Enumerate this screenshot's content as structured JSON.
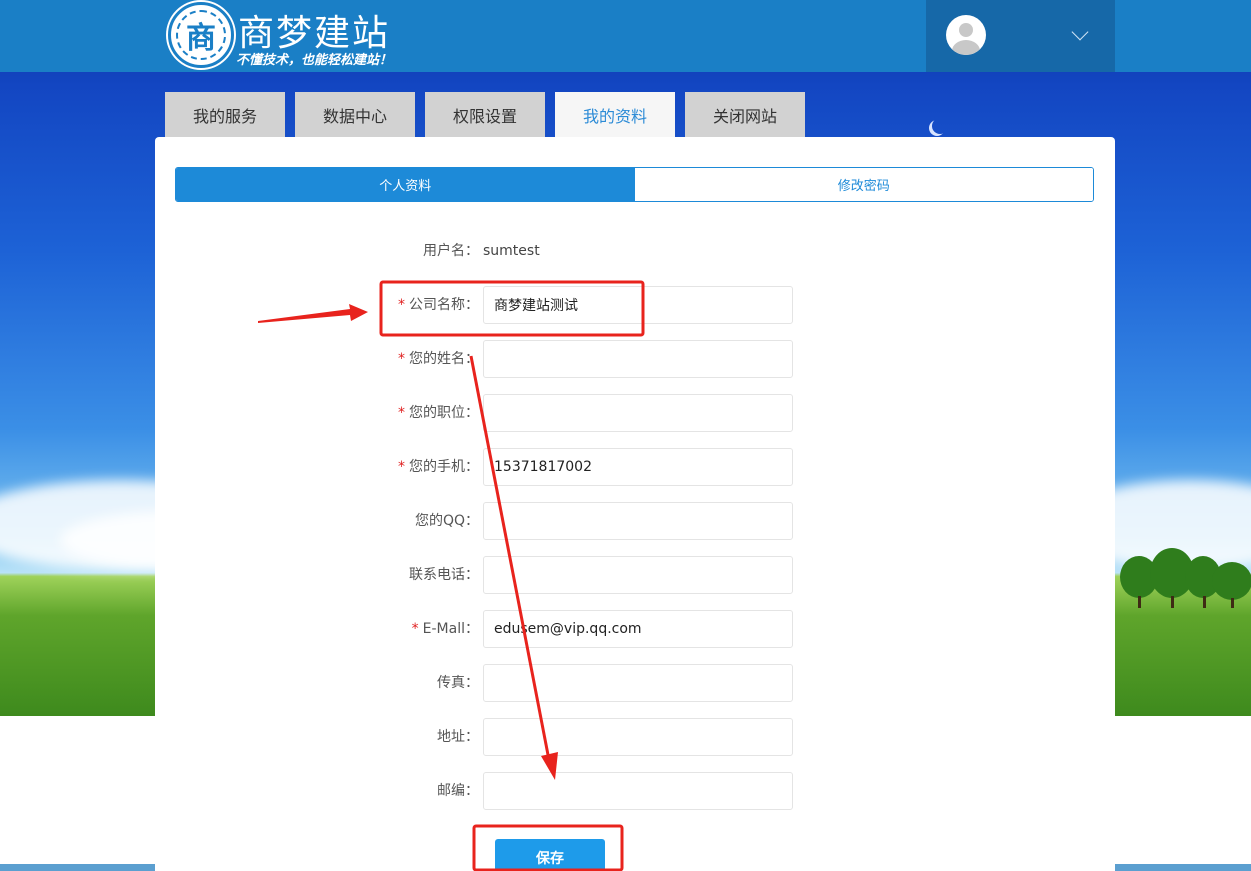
{
  "header": {
    "logo_glyph": "商",
    "brand_title": "商梦建站",
    "brand_slogan": "不懂技术，也能轻松建站！",
    "user_icon": "avatar-icon",
    "dropdown_icon": "chevron-down-icon"
  },
  "main_tabs": [
    {
      "label": "我的服务",
      "active": false
    },
    {
      "label": "数据中心",
      "active": false
    },
    {
      "label": "权限设置",
      "active": false
    },
    {
      "label": "我的资料",
      "active": true
    },
    {
      "label": "关闭网站",
      "active": false
    }
  ],
  "sub_tabs": [
    {
      "label": "个人资料",
      "active": true
    },
    {
      "label": "修改密码",
      "active": false
    }
  ],
  "form": {
    "username": {
      "label": "用户名：",
      "value": "sumtest"
    },
    "fields": [
      {
        "label": "公司名称：",
        "required": true,
        "value": "商梦建站测试"
      },
      {
        "label": "您的姓名：",
        "required": true,
        "value": ""
      },
      {
        "label": "您的职位：",
        "required": true,
        "value": ""
      },
      {
        "label": "您的手机：",
        "required": true,
        "value": "15371817002"
      },
      {
        "label": "您的QQ：",
        "required": false,
        "value": ""
      },
      {
        "label": "联系电话：",
        "required": false,
        "value": ""
      },
      {
        "label": "E-Mall：",
        "required": true,
        "value": "edusem@vip.qq.com"
      },
      {
        "label": "传真：",
        "required": false,
        "value": ""
      },
      {
        "label": "地址：",
        "required": false,
        "value": ""
      },
      {
        "label": "邮编：",
        "required": false,
        "value": ""
      }
    ],
    "required_mark": "*",
    "save_label": "保存"
  },
  "colors": {
    "header": "#1a7fc6",
    "accent": "#1d8ad8",
    "save_button": "#1e9bea",
    "annotation": "#e8231d"
  }
}
